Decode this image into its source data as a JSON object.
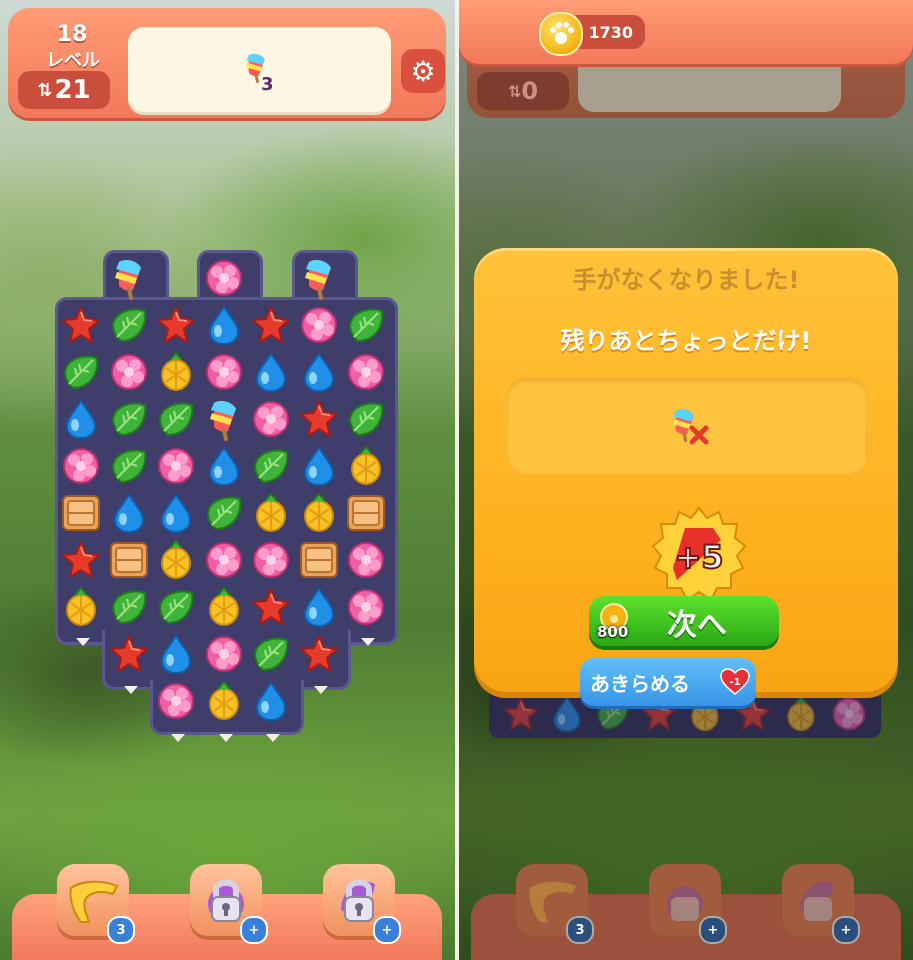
{
  "left": {
    "level": {
      "number": "18",
      "label": "レベル"
    },
    "moves": {
      "icon": "swap-arrows-icon",
      "value": "21"
    },
    "goal": {
      "item": "popsicle",
      "count": "3"
    },
    "settings_icon": "gear-icon",
    "board": {
      "tiles": [
        [
          null,
          "pop",
          null,
          "flower",
          null,
          "pop",
          null
        ],
        [
          "star",
          "leaf",
          "star",
          "drop",
          "star",
          "flower",
          "leaf"
        ],
        [
          "leaf",
          "flower",
          "pine",
          "flower",
          "drop",
          "drop",
          "flower"
        ],
        [
          "drop",
          "leaf",
          "leaf",
          "pop",
          "flower",
          "star",
          "leaf"
        ],
        [
          "flower",
          "leaf",
          "flower",
          "drop",
          "leaf",
          "drop",
          "pine"
        ],
        [
          "crate",
          "drop",
          "drop",
          "leaf",
          "pine",
          "pine",
          "crate"
        ],
        [
          "star",
          "crate",
          "pine",
          "flower",
          "flower",
          "crate",
          "flower"
        ],
        [
          "pine",
          "leaf",
          "leaf",
          "pine",
          "star",
          "drop",
          "flower"
        ],
        [
          null,
          "star",
          "drop",
          "flower",
          "leaf",
          "star",
          null
        ],
        [
          null,
          null,
          "flower",
          "pine",
          "drop",
          null,
          null
        ]
      ]
    },
    "boosters": [
      {
        "name": "boomerang",
        "icon": "boomerang-icon",
        "badge": "3"
      },
      {
        "name": "locked-booster-1",
        "icon": "lock-icon",
        "badge": "+"
      },
      {
        "name": "locked-booster-2",
        "icon": "lock-icon",
        "badge": "+"
      }
    ]
  },
  "right": {
    "coins": {
      "icon": "paw-coin-icon",
      "value": "1730"
    },
    "moves": {
      "icon": "swap-arrows-icon",
      "value": "0"
    },
    "dialog": {
      "title": "手がなくなりました!",
      "subtitle": "残りあとちょっとだけ!",
      "goal_item": "popsicle",
      "goal_status": "x",
      "bonus": "+5",
      "next_label": "次へ",
      "next_price": "800",
      "giveup_label": "あきらめる",
      "giveup_cost": "-1"
    },
    "boosters": [
      {
        "name": "boomerang",
        "icon": "boomerang-icon",
        "badge": "3"
      },
      {
        "name": "locked-booster-1",
        "icon": "lock-icon",
        "badge": "+"
      },
      {
        "name": "locked-booster-2",
        "icon": "lock-icon",
        "badge": "+"
      }
    ]
  },
  "colors": {
    "hud": "#f2785a",
    "board": "#3f3d6a",
    "dialog": "#ffb21f",
    "next_button": "#28a914",
    "giveup_button": "#3794e8"
  }
}
